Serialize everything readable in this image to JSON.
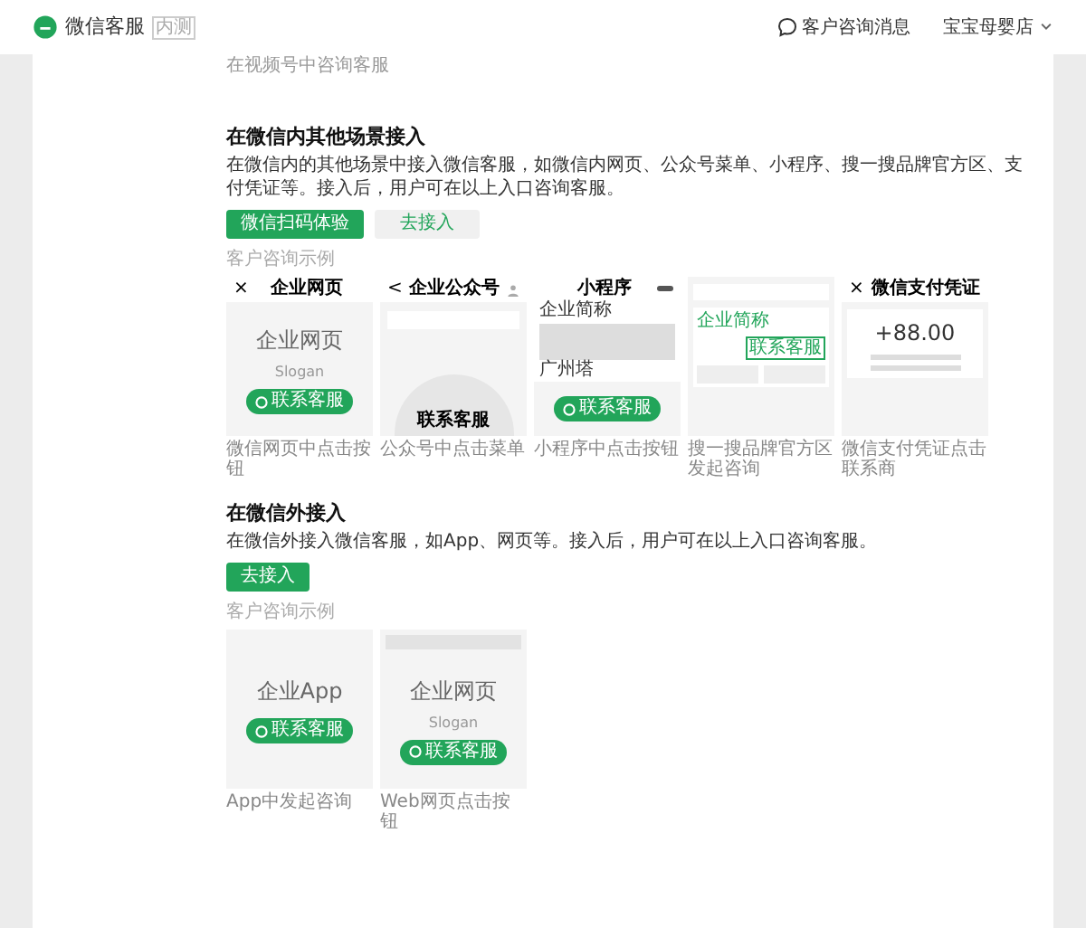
{
  "header": {
    "logo_text": "微信客服",
    "badge": "内测",
    "messages": "客户咨询消息",
    "account": "宝宝母婴店"
  },
  "top_note": "在视频号中咨询客服",
  "sections": [
    {
      "title": "在微信内其他场景接入",
      "description": "在微信内的其他场景中接入微信客服，如微信内网页、公众号菜单、小程序、搜一搜品牌官方区、支付凭证等。接入后，用户可在以上入口咨询客服。",
      "buttons": [
        {
          "label": "微信扫码体验",
          "kind": "primary"
        },
        {
          "label": "去接入",
          "kind": "secondary"
        }
      ],
      "examples_label": "客户咨询示例",
      "examples": [
        {
          "kind": "webpage",
          "close": "×",
          "title": "企业网页",
          "name": "企业网页",
          "slogan": "Slogan",
          "button": "联系客服",
          "caption": "微信网页中点击按钮"
        },
        {
          "kind": "official_account",
          "back": "<",
          "title": "企业公众号",
          "button": "联系客服",
          "caption": "公众号中点击菜单"
        },
        {
          "kind": "mini_program",
          "title": "小程序",
          "name": "企业简称",
          "place": "广州塔",
          "button": "联系客服",
          "caption": "小程序中点击按钮"
        },
        {
          "kind": "search",
          "name": "企业简称",
          "button": "联系客服",
          "caption": "搜一搜品牌官方区发起咨询"
        },
        {
          "kind": "payment",
          "close": "×",
          "title": "微信支付凭证",
          "amount": "+88.00",
          "caption": "微信支付凭证点击联系商"
        }
      ]
    },
    {
      "title": "在微信外接入",
      "description": "在微信外接入微信客服，如App、网页等。接入后，用户可在以上入口咨询客服。",
      "buttons": [
        {
          "label": "去接入",
          "kind": "primary"
        }
      ],
      "examples_label": "客户咨询示例",
      "examples": [
        {
          "kind": "app",
          "name": "企业App",
          "button": "联系客服",
          "caption": "App中发起咨询"
        },
        {
          "kind": "web",
          "name": "企业网页",
          "slogan": "Slogan",
          "button": "联系客服",
          "caption": "Web网页点击按钮"
        }
      ]
    }
  ]
}
